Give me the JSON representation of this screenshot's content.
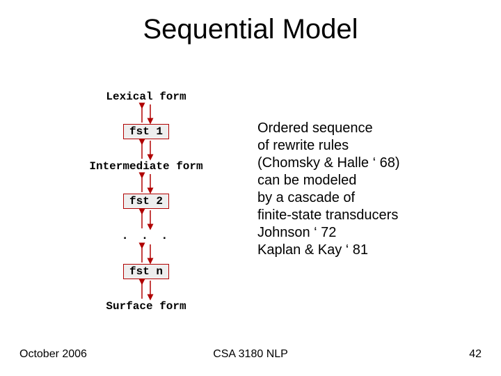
{
  "title": "Sequential Model",
  "diagram": {
    "lexical": "Lexical form",
    "fst1": "fst 1",
    "intermediate": "Intermediate form",
    "fst2": "fst 2",
    "dots": ". . .",
    "fstn": "fst n",
    "surface": "Surface form"
  },
  "desc": {
    "l1": "Ordered sequence",
    "l2": "of rewrite rules",
    "l3": "(Chomsky & Halle ‘ 68)",
    "l4": "can be modeled",
    "l5": "by a cascade of",
    "l6": "finite-state transducers",
    "l7": "Johnson ‘ 72",
    "l8": "Kaplan & Kay ‘ 81"
  },
  "footer": {
    "date": "October 2006",
    "course": "CSA 3180 NLP",
    "page": "42"
  },
  "colors": {
    "arrow": "#b00000",
    "boxBorder": "#b00000"
  }
}
